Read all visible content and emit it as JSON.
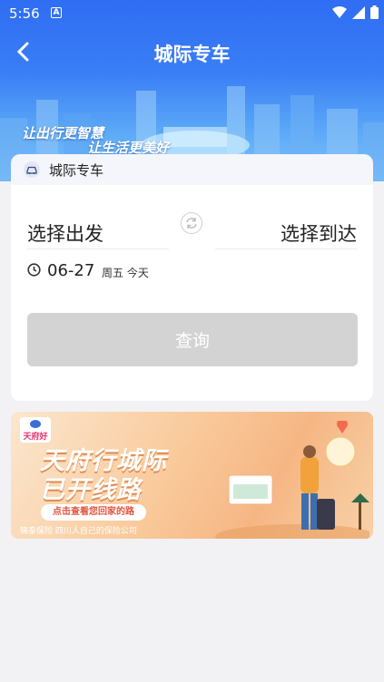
{
  "status": {
    "time": "5:56",
    "notif": "A"
  },
  "header": {
    "title": "城际专车"
  },
  "slogan": {
    "line1": "让出行更智慧",
    "line2": "让生活更美好"
  },
  "tab": {
    "label": "城际专车"
  },
  "form": {
    "from_label": "选择出发",
    "to_label": "选择到达",
    "date": "06-27",
    "weekday": "周五 今天",
    "query_button": "查询"
  },
  "banner": {
    "logo_text": "天府好",
    "title_line1": "天府行城际",
    "title_line2": "已开线路",
    "button": "点击查看您回家的路",
    "footer": "锦泰保险 四川人自己的保险公司"
  },
  "colors": {
    "header": "#2f6df3",
    "button_disabled": "#d3d3d3",
    "accent": "#e0553e"
  }
}
